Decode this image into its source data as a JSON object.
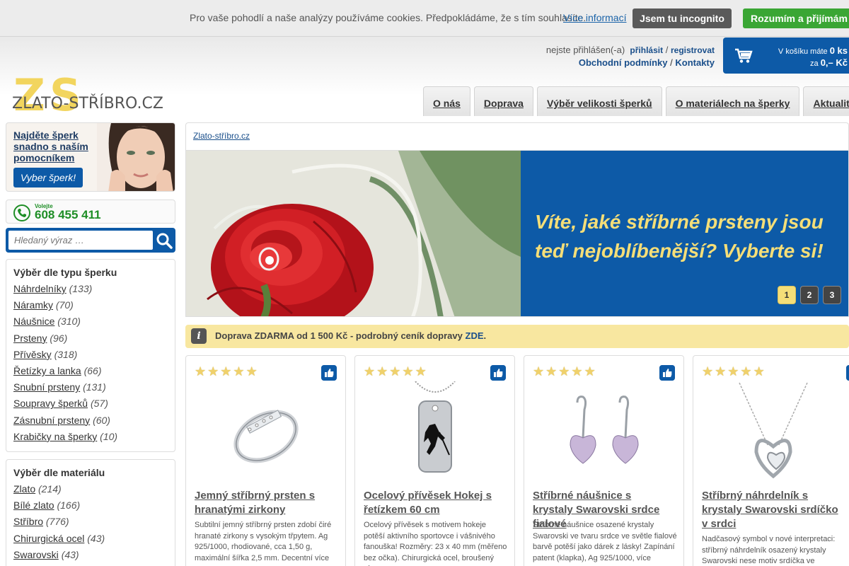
{
  "cookie": {
    "message": "Pro vaše pohodlí a naše analýzy používáme cookies. Předpokládáme, že s tím souhlasíte.",
    "more_link": "Více informací",
    "incognito_button": "Jsem tu incognito",
    "accept_button": "Rozumím a přijímám"
  },
  "header": {
    "login_status": "nejste přihlášen(-a)",
    "login_link": "přihlásit",
    "separator": "/",
    "register_link": "registrovat",
    "terms_link": "Obchodní podmínky",
    "contacts_link": "Kontakty",
    "logo_mark": "ZS",
    "logo_text": "ZLATO-STŘÍBRO.CZ"
  },
  "cart": {
    "line1_prefix": "V košíku máte",
    "count": "0 ks",
    "line2_prefix": "za",
    "price": "0,– Kč"
  },
  "nav": {
    "tabs": [
      "O nás",
      "Doprava",
      "Výběr velikosti šperků",
      "O materiálech na šperky",
      "Aktuality"
    ]
  },
  "finder": {
    "title": "Najděte šperk snadno s naším pomocníkem",
    "button": "Vyber šperk!"
  },
  "phone": {
    "label": "Volejte",
    "number": "608 455 411"
  },
  "search": {
    "placeholder": "Hledaný výraz …"
  },
  "categories_type": {
    "heading": "Výběr dle typu šperku",
    "items": [
      {
        "label": "Náhrdelníky",
        "count": "(133)"
      },
      {
        "label": "Náramky",
        "count": "(70)"
      },
      {
        "label": "Náušnice",
        "count": "(310)"
      },
      {
        "label": "Prsteny",
        "count": "(96)"
      },
      {
        "label": "Přívěsky",
        "count": "(318)"
      },
      {
        "label": "Řetízky a lanka",
        "count": "(66)"
      },
      {
        "label": "Snubní prsteny",
        "count": "(131)"
      },
      {
        "label": "Soupravy šperků",
        "count": "(57)"
      },
      {
        "label": "Zásnubní prsteny",
        "count": "(60)"
      },
      {
        "label": "Krabičky na šperky",
        "count": "(10)"
      }
    ]
  },
  "categories_material": {
    "heading": "Výběr dle materiálu",
    "items": [
      {
        "label": "Zlato",
        "count": "(214)"
      },
      {
        "label": "Bílé zlato",
        "count": "(166)"
      },
      {
        "label": "Stříbro",
        "count": "(776)"
      },
      {
        "label": "Chirurgická ocel",
        "count": "(43)"
      },
      {
        "label": "Swarovski",
        "count": "(43)"
      }
    ]
  },
  "breadcrumb": {
    "home": "Zlato-stříbro.cz"
  },
  "banner": {
    "headline": "Víte, jaké stříbrné prsteny jsou teď nejoblíbenější? Vyberte si!",
    "pages": [
      "1",
      "2",
      "3"
    ],
    "active_page": "1"
  },
  "info": {
    "icon": "i",
    "text": "Doprava ZDARMA od 1 500 Kč - podrobný ceník dopravy",
    "link": "ZDE",
    "suffix": "."
  },
  "products": [
    {
      "title": "Jemný stříbrný prsten s hranatými zirkony",
      "description": "Subtilní jemný stříbrný prsten zdobí čiré hranaté zirkony s vysokým třpytem. Ag 925/1000, rhodiované, cca 1,50 g, maximální šířka 2,5 mm. Decentní více"
    },
    {
      "title": "Ocelový přívěsek Hokej s řetízkem 60 cm",
      "description": "Ocelový přívěsek s motivem hokeje potěší aktivního sportovce i vášnivého fanouška! Rozměry: 23 x 40 mm (měřeno bez očka). Chirurgická ocel, broušený více"
    },
    {
      "title": "Stříbrné náušnice s krystaly Swarovski srdce fialové",
      "description": "Stříbrné náušnice osazené krystaly Swarovski ve tvaru srdce ve světle fialové barvě potěší jako dárek z lásky! Zapínání patent (klapka), Ag 925/1000, více"
    },
    {
      "title": "Stříbrný náhrdelník s krystaly Swarovski srdíčko v srdci",
      "description": "Nadčasový symbol v nové interpretaci: stříbrný náhrdelník osazený krystaly Swarovski nese motiv srdíčka ve"
    }
  ],
  "colors": {
    "brand_blue": "#0d5aa7",
    "accept_green": "#3aa634",
    "headline_yellow": "#f5de78",
    "info_bg": "#f8e7a0"
  }
}
